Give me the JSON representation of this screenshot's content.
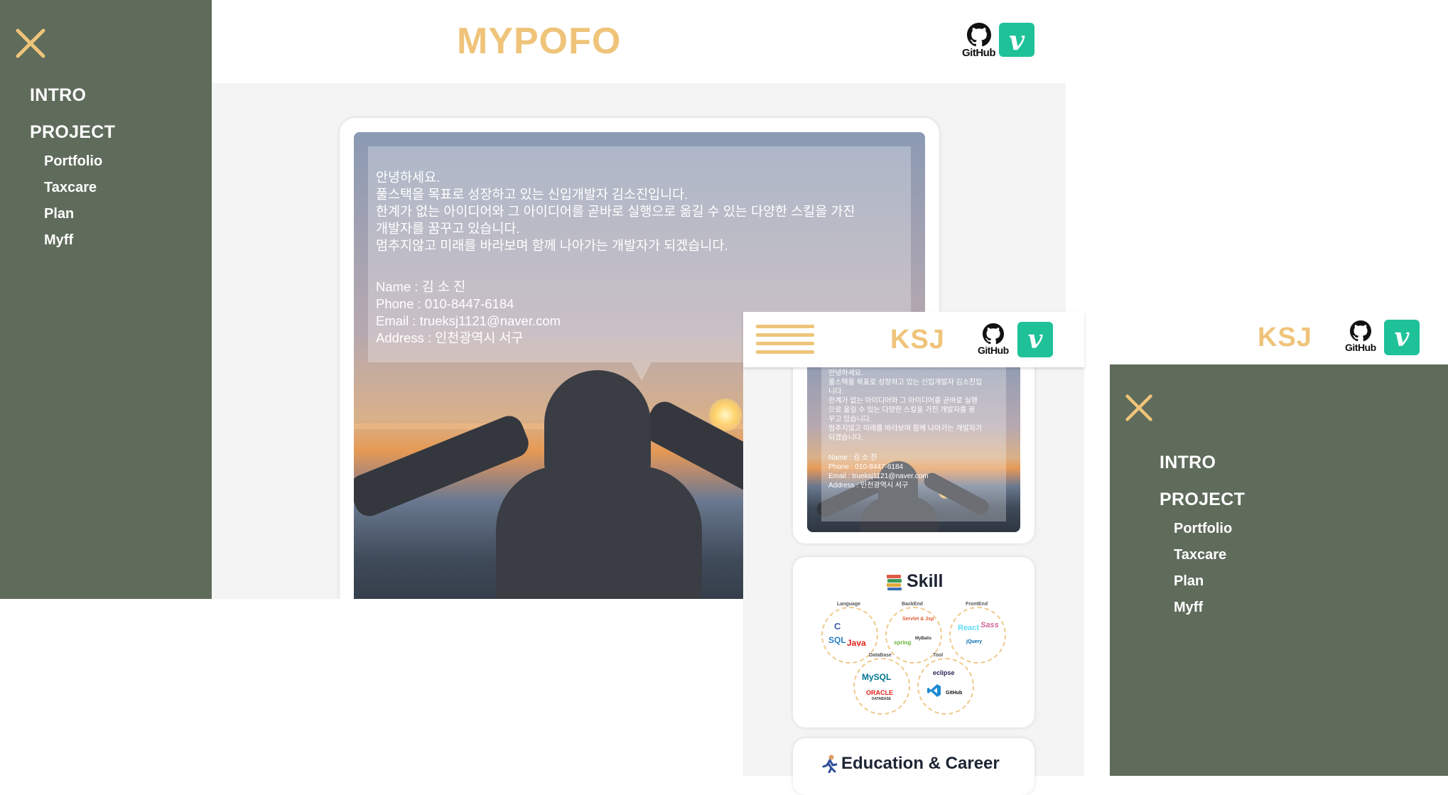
{
  "desktop": {
    "brand": "MYPOFO",
    "nav": {
      "intro": "INTRO",
      "project": "PROJECT",
      "items": [
        "Portfolio",
        "Taxcare",
        "Plan",
        "Myff"
      ]
    },
    "github_label": "GitHub",
    "velog_label": "v",
    "intro": {
      "greeting": "안녕하세요.\n풀스택을 목표로 성장하고 있는 신입개발자 김소진입니다.\n한계가 없는 아이디어와 그 아이디어를 곧바로 실행으로 옮길 수 있는 다양한 스킬을 가진\n개발자를 꿈꾸고 있습니다.\n멈추지않고 미래를 바라보며 함께 나아가는 개발자가 되겠습니다.",
      "name": "Name : 김 소 진",
      "phone": "Phone : 010-8447-6184",
      "email": "Email : trueksj1121@naver.com",
      "address": "Address : 인천광역시 서구"
    }
  },
  "tablet": {
    "brand": "KSJ",
    "github_label": "GitHub",
    "velog_label": "v",
    "intro": {
      "greeting": "안녕하세요.\n풀스택을 목표로 성장하고 있는 신입개발자 김소진입\n니다.\n한계가 없는 아이디어와 그 아이디어를 곧바로 실행\n으로 옮길 수 있는 다양한 스킬을 가진 개발자를 꿈\n꾸고 있습니다.\n멈추지않고 미래를 바라보며 함께 나아가는 개발자가\n되겠습니다.",
      "name": "Name : 김 소 진",
      "phone": "Phone : 010-8447-6184",
      "email": "Email : trueksj1121@naver.com",
      "address": "Address : 인천광역시 서구"
    },
    "skill": {
      "title": "Skill",
      "groups": [
        "Language",
        "BackEnd",
        "FrontEnd",
        "DataBase",
        "Tool"
      ],
      "logos": {
        "sql": "SQL",
        "java": "Java",
        "c": "C",
        "servlet": "Servlet & Jsp",
        "spring": "spring",
        "mybatis": "MyBatis",
        "react": "React",
        "sass": "Sass",
        "jquery": "jQuery",
        "mysql": "MySQL",
        "oracle": "ORACLE",
        "oracle_db": "DATABASE",
        "eclipse": "eclipse",
        "github": "GitHub"
      }
    },
    "education_title": "Education & Career"
  },
  "mobile_menu": {
    "brand": "KSJ",
    "github_label": "GitHub",
    "velog_label": "v",
    "nav": {
      "intro": "INTRO",
      "project": "PROJECT",
      "items": [
        "Portfolio",
        "Taxcare",
        "Plan",
        "Myff"
      ]
    }
  },
  "colors": {
    "sidebar": "#5f6b5b",
    "brand": "#efc47a",
    "velog": "#1fc198",
    "page_bg": "#f4f4f4"
  }
}
